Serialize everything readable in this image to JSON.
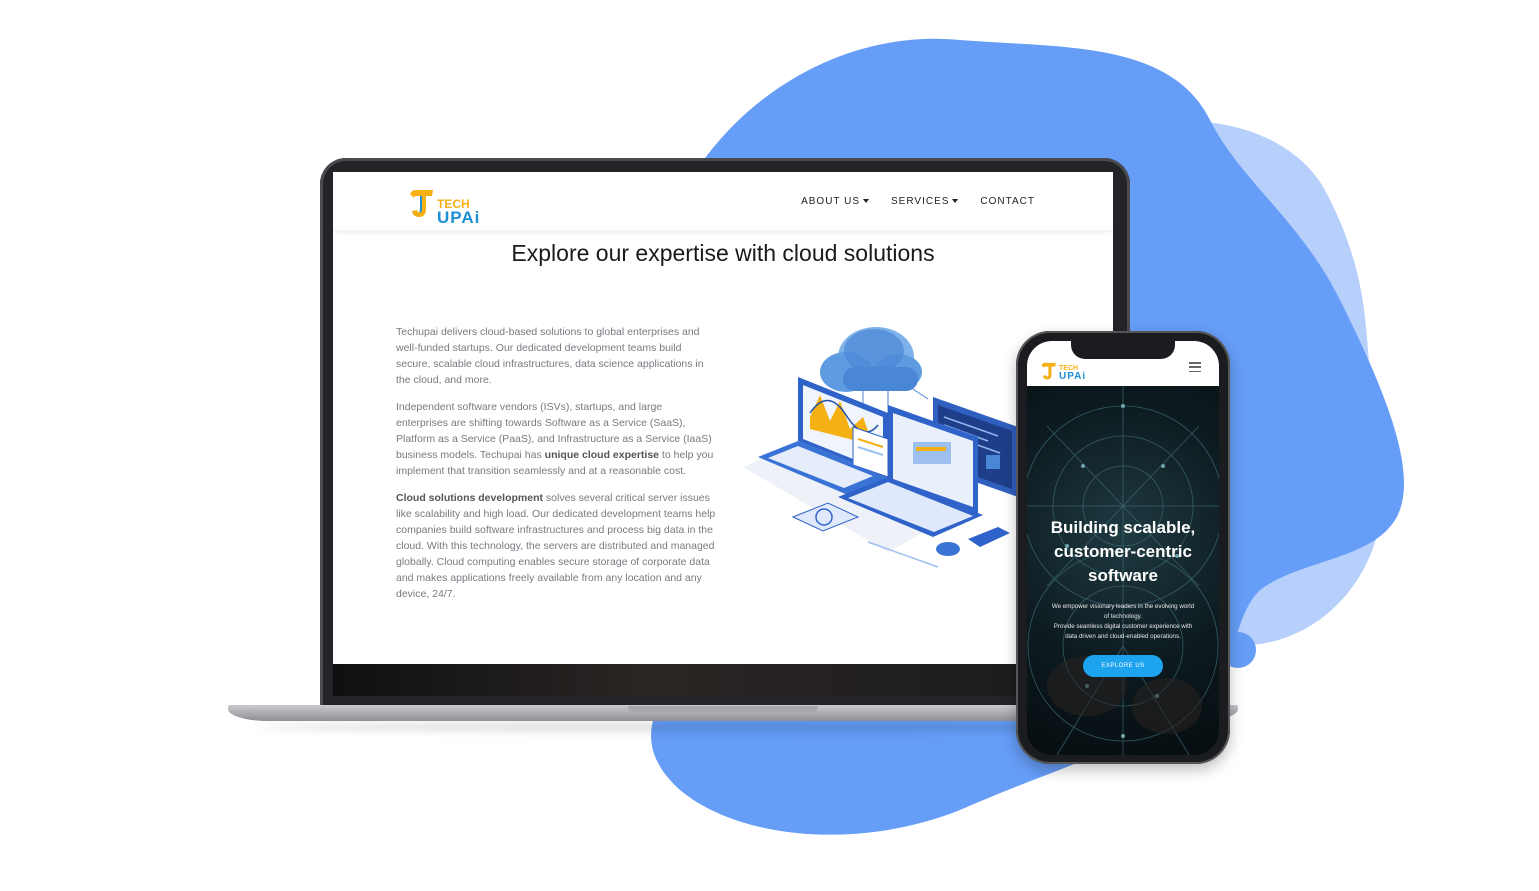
{
  "colors": {
    "blob_main": "#669df7",
    "blob_light": "#b7d0fb",
    "brand_yellow": "#f5b014",
    "brand_blue": "#1c8fd7",
    "button_blue": "#1ea3ef"
  },
  "laptop": {
    "logo": {
      "tech": "TECH",
      "upai": "UPAi",
      "icon": "techupai-logo-icon"
    },
    "nav": [
      {
        "label": "ABOUT US",
        "dropdown": true
      },
      {
        "label": "SERVICES",
        "dropdown": true
      },
      {
        "label": "CONTACT",
        "dropdown": false
      }
    ],
    "heading": "Explore our expertise with cloud solutions",
    "paragraphs": {
      "p1": "Techupai delivers cloud-based solutions to global enterprises and well-funded startups. Our dedicated development teams build secure, scalable cloud infrastructures, data science applications in the cloud, and more.",
      "p2_before": "Independent software vendors (ISVs), startups, and large enterprises are shifting towards Software as a Service (SaaS), Platform as a Service (PaaS), and Infrastructure as a Service (IaaS) business models. Techupai has ",
      "p2_bold": "unique cloud expertise",
      "p2_after": " to help you implement that transition seamlessly and at a reasonable cost.",
      "p3_bold": "Cloud solutions development",
      "p3_after": " solves several critical server issues like scalability and high load. Our dedicated development teams help companies build software infrastructures and process big data in the cloud. With this technology, the servers are distributed and managed globally. Cloud computing enables secure storage of corporate data and makes applications freely available from any location and any device, 24/7."
    },
    "illustration": "cloud-computing-illustration"
  },
  "phone": {
    "logo": {
      "tech": "TECH",
      "upai": "UPAi"
    },
    "menu_icon": "hamburger-icon",
    "hero_title_lines": [
      "Building scalable,",
      "customer-centric",
      "software"
    ],
    "hero_sub_lines": [
      "We empower visionary leaders in the evolving world",
      "of technology.",
      "Provide seamless digital customer experience with",
      "data driven and cloud-enabled operations."
    ],
    "cta": "EXPLORE US"
  }
}
